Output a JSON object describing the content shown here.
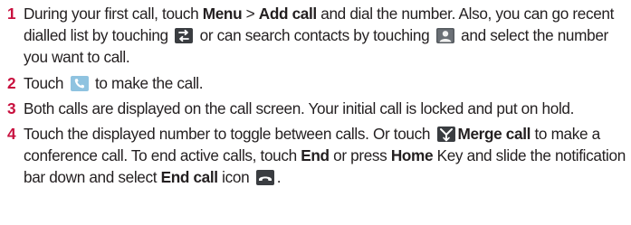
{
  "steps": [
    {
      "number": "1",
      "t1": "During your first call, touch ",
      "b1": "Menu",
      "t2": " > ",
      "b2": "Add call",
      "t3": " and dial the number. Also, you can go recent dialled list by touching ",
      "t4": " or can search contacts by touching ",
      "t5": " and select the number you want to call.",
      "icon1": "recent-calls-icon",
      "icon2": "contacts-icon"
    },
    {
      "number": "2",
      "t1": "Touch ",
      "t2": " to make the call.",
      "icon1": "phone-call-icon"
    },
    {
      "number": "3",
      "t1": "Both calls are displayed on the call screen. Your initial call is locked and put on hold."
    },
    {
      "number": "4",
      "t1": "Touch the displayed number to toggle between calls. Or touch ",
      "b1": "Merge call",
      "t2": " to make a conference call. To end active calls, touch ",
      "b2": "End",
      "t3": " or press ",
      "b3": "Home",
      "t4": " Key and slide the notification bar down and select ",
      "b4": "End call",
      "t5": " icon ",
      "t6": ".",
      "icon1": "merge-call-icon",
      "icon2": "end-call-icon"
    }
  ],
  "colors": {
    "step_number": "#c8103e",
    "text": "#231f20",
    "icon_dark": "#3a3d41",
    "icon_light": "#8fc3e0"
  }
}
